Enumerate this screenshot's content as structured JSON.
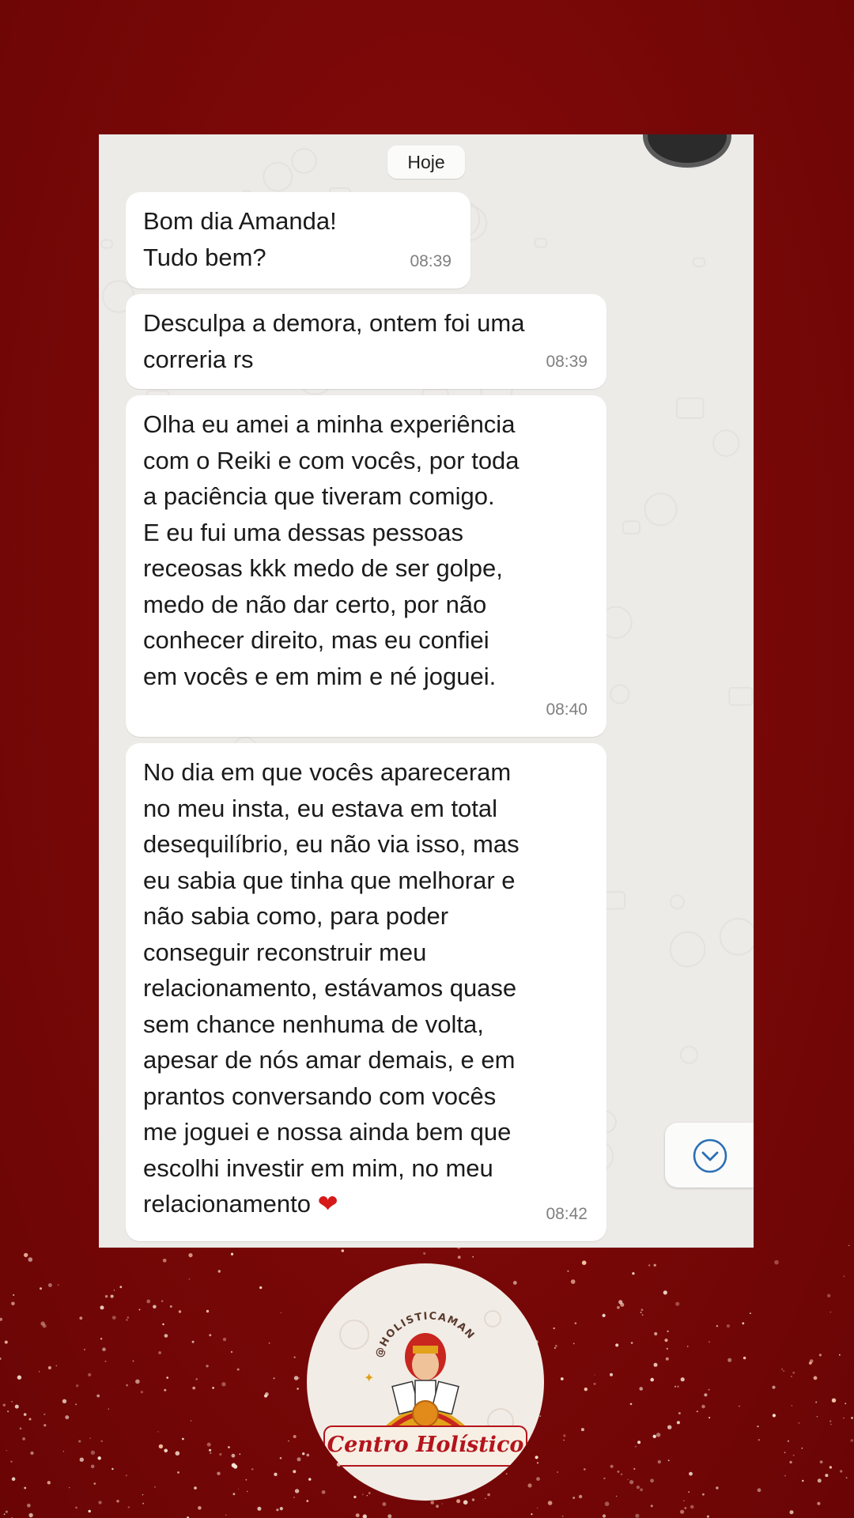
{
  "chat": {
    "date_label": "Hoje",
    "messages": [
      {
        "text": "Bom dia Amanda!\nTudo bem?",
        "time": "08:39"
      },
      {
        "text": "Desculpa a demora, ontem foi uma\ncorreria rs",
        "time": "08:39"
      },
      {
        "text": "Olha eu amei a minha experiência\ncom o Reiki e com vocês, por toda\na paciência que tiveram comigo.\nE eu fui uma dessas pessoas\nreceosas kkk medo de ser golpe,\nmedo de não dar certo, por não\nconhecer direito, mas eu confiei\nem vocês e em mim e né joguei.",
        "time": "08:40"
      },
      {
        "text": "No dia em que vocês apareceram\nno meu insta, eu estava em total\ndesequilíbrio, eu não via isso, mas\neu sabia que tinha que melhorar e\nnão sabia como, para poder\nconseguir reconstruir meu\nrelacionamento, estávamos quase\nsem chance nenhuma de volta,\napesar de nós amar demais, e em\nprantos conversando com vocês\nme joguei e nossa ainda bem que\nescolhi investir em mim, no meu\nrelacionamento",
        "emoji": "❤",
        "time": "08:42"
      }
    ]
  },
  "icons": {
    "scroll_down": "chevron-down-circle-icon",
    "heart": "red-heart-emoji"
  },
  "brand": {
    "handle": "@HOLISTICAMANDY",
    "name": "Centro Holístico"
  },
  "colors": {
    "background": "#7a0a0a",
    "bubble": "#ffffff",
    "chat_wallpaper": "#ecebe8",
    "accent_blue": "#2a6fb5",
    "brand_red": "#b4141c"
  }
}
